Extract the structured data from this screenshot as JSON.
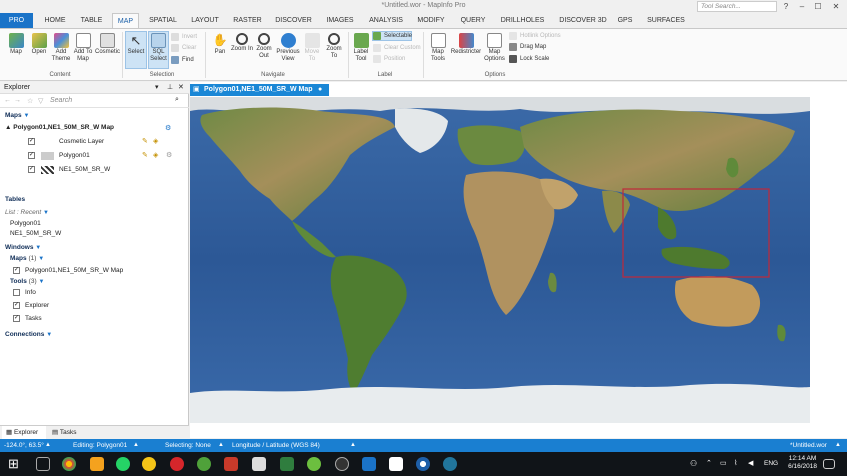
{
  "window": {
    "title": "*Untitled.wor - MapInfo Pro",
    "search_placeholder": "Tool Search..."
  },
  "tabs": [
    "PRO",
    "HOME",
    "TABLE",
    "MAP",
    "SPATIAL",
    "LAYOUT",
    "RASTER",
    "DISCOVER",
    "IMAGES",
    "ANALYSIS",
    "MODIFY",
    "QUERY",
    "DRILLHOLES",
    "DISCOVER 3D",
    "GPS",
    "SURFACES"
  ],
  "active_tab": "MAP",
  "ribbon": {
    "groups": {
      "content": "Content",
      "selection": "Selection",
      "navigate": "Navigate",
      "label": "Label",
      "options": "Options"
    },
    "map": "Map",
    "open": "Open",
    "add_theme": "Add Theme",
    "add_to_map": "Add To Map",
    "cosmetic": "Cosmetic",
    "select": "Select",
    "sql_select": "SQL Select",
    "invert": "Invert",
    "clear": "Clear",
    "find": "Find",
    "pan": "Pan",
    "zoom_in": "Zoom In",
    "zoom_out": "Zoom Out",
    "previous_view": "Previous View",
    "move_to": "Move To",
    "zoom_to": "Zoom To",
    "label_tool": "Label Tool",
    "selectable": "Selectable",
    "clear_custom": "Clear Custom",
    "position": "Position",
    "map_tools": "Map Tools",
    "redistricter": "Redistricter",
    "map_options": "Map Options",
    "hotlink_options": "Hotlink Options",
    "drag_map": "Drag Map",
    "lock_scale": "Lock Scale"
  },
  "explorer": {
    "title": "Explorer",
    "search_placeholder": "Search",
    "maps_header": "Maps",
    "map_name": "Polygon01,NE1_50M_SR_W Map",
    "layers": [
      "Cosmetic Layer",
      "Polygon01",
      "NE1_50M_SR_W"
    ],
    "tables_header": "Tables",
    "list_label": "List : Recent",
    "tables": [
      "Polygon01",
      "NE1_50M_SR_W"
    ],
    "windows_header": "Windows",
    "maps_count": "Maps",
    "maps_count_num": "(1)",
    "window_map": "Polygon01,NE1_50M_SR_W Map",
    "tools_count": "Tools",
    "tools_count_num": "(3)",
    "tools": [
      "Info",
      "Explorer",
      "Tasks"
    ],
    "connections_header": "Connections",
    "bottom_tabs": [
      "Explorer",
      "Tasks"
    ]
  },
  "map_window": {
    "tab_label": "Polygon01,NE1_50M_SR_W Map"
  },
  "status": {
    "coords": "-124.0°, 63.5°",
    "editing": "Editing: Polygon01",
    "selecting": "Selecting: None",
    "projection": "Longitude / Latitude (WGS 84)",
    "workspace": "*Untitled.wor"
  },
  "taskbar": {
    "lang": "ENG",
    "time": "12:14 AM",
    "date": "6/16/2018"
  },
  "colors": {
    "accent": "#1a7fd1",
    "selection_rect": "#c0283a",
    "ocean": "#2d5a9a"
  }
}
